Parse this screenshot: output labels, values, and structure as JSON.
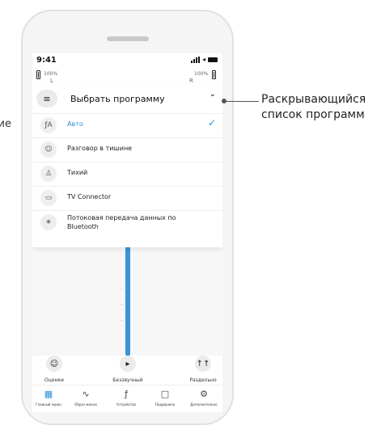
{
  "left_cutoff_text": "ие",
  "status": {
    "time": "9:41"
  },
  "hearing": {
    "left_pct": "100%",
    "left_side": "L",
    "right_pct": "100%",
    "right_side": "R"
  },
  "dropdown": {
    "title": "Выбрать программу",
    "options": [
      {
        "label": "Авто",
        "icon": "ear-auto-icon",
        "selected": true
      },
      {
        "label": "Разговор в тишине",
        "icon": "conversation-icon",
        "selected": false
      },
      {
        "label": "Тихий",
        "icon": "person-quiet-icon",
        "selected": false
      },
      {
        "label": "TV Connector",
        "icon": "tv-icon",
        "selected": false
      },
      {
        "label": "Потоковая передача данных по Bluetooth",
        "icon": "bluetooth-icon",
        "selected": false
      }
    ]
  },
  "volume": {
    "level": 0.84
  },
  "actions": [
    {
      "label": "Оценки",
      "icon": "smiley-icon"
    },
    {
      "label": "Беззвучный",
      "icon": "speaker-mute-icon"
    },
    {
      "label": "Раздельно",
      "icon": "split-icon"
    }
  ],
  "nav": [
    {
      "label": "Главный экран",
      "icon": "home-grid-icon",
      "active": true
    },
    {
      "label": "Образ жизни",
      "icon": "lifestyle-icon",
      "active": false
    },
    {
      "label": "Устройства",
      "icon": "devices-icon",
      "active": false
    },
    {
      "label": "Поддержка",
      "icon": "chat-icon",
      "active": false
    },
    {
      "label": "Дополнительно",
      "icon": "gear-icon",
      "active": false
    }
  ],
  "callout": {
    "line1": "Раскрывающийся",
    "line2": "список программ"
  },
  "colors": {
    "accent": "#2e8fd6",
    "slider": "#3a94d8"
  }
}
